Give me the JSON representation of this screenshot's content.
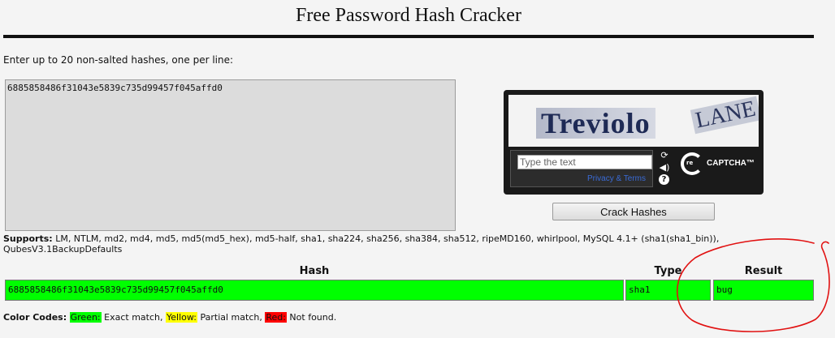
{
  "page_title": "Free Password Hash Cracker",
  "instructions": "Enter up to 20 non-salted hashes, one per line:",
  "hash_input_value": "6885858486f31043e5839c735d99457f045affd0",
  "captcha": {
    "word1": "Treviolo",
    "word2": "LANE",
    "placeholder": "Type the text",
    "privacy_link": "Privacy & Terms",
    "brand_prefix": "re",
    "brand": "CAPTCHA™",
    "refresh_icon": "refresh-icon",
    "audio_icon": "audio-icon",
    "help_icon": "help-icon",
    "help_glyph": "?"
  },
  "crack_button_label": "Crack Hashes",
  "supports": {
    "label": "Supports:",
    "text": " LM, NTLM, md2, md4, md5, md5(md5_hex), md5-half, sha1, sha224, sha256, sha384, sha512, ripeMD160, whirlpool, MySQL 4.1+ (sha1(sha1_bin)), QubesV3.1BackupDefaults"
  },
  "results_table": {
    "headers": [
      "Hash",
      "Type",
      "Result"
    ],
    "rows": [
      {
        "hash": "6885858486f31043e5839c735d99457f045affd0",
        "type": "sha1",
        "result": "bug",
        "status_color": "#00ff00"
      }
    ]
  },
  "color_codes": {
    "label": "Color Codes:",
    "green": {
      "name": "Green:",
      "desc": " Exact match, ",
      "color": "#00ff00"
    },
    "yellow": {
      "name": "Yellow:",
      "desc": " Partial match, ",
      "color": "#ffff00"
    },
    "red": {
      "name": "Red:",
      "desc": " Not found.",
      "color": "#ff0000"
    }
  },
  "annotation_color": "#e11111"
}
